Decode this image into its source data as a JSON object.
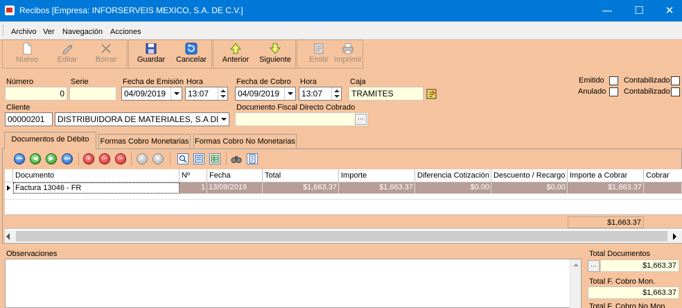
{
  "window": {
    "title": "Recibos [Empresa: INFORSERVEIS MEXICO, S.A. DE C.V.]",
    "minimize_glyph": "—",
    "maximize_glyph": "☐",
    "close_glyph": "✕"
  },
  "menu": [
    "Archivo",
    "Ver",
    "Navegación",
    "Acciones"
  ],
  "toolbar": {
    "nuevo": "Nuevo",
    "editar": "Editar",
    "borrar": "Borrar",
    "guardar": "Guardar",
    "cancelar": "Cancelar",
    "anterior": "Anterior",
    "siguiente": "Siguiente",
    "emitir": "Emitir",
    "imprimir": "Imprimir"
  },
  "form": {
    "numero_label": "Número",
    "numero_value": "0",
    "serie_label": "Serie",
    "serie_value": "",
    "fecha_emision_label": "Fecha de Emisión",
    "fecha_emision_value": "04/09/2019",
    "hora_emision_label": "Hora",
    "hora_emision_value": "13:07",
    "fecha_cobro_label": "Fecha de Cobro",
    "fecha_cobro_value": "04/09/2019",
    "hora_cobro_label": "Hora",
    "hora_cobro_value": "13:07",
    "caja_label": "Caja",
    "caja_value": "TRAMITES",
    "emitido_label": "Emitido",
    "anulado_label": "Anulado",
    "contabilizado1_label": "Contabilizado",
    "contabilizado2_label": "Contabilizado",
    "cliente_label": "Cliente",
    "cliente_code": "00000201",
    "cliente_name": "DISTRIBUIDORA  DE MATERIALES, S.A  DE C.V.",
    "doc_fiscal_label": "Documento Fiscal Directo Cobrado",
    "doc_fiscal_value": "",
    "ellipsis": "···"
  },
  "tabs": [
    {
      "label": "Documentos de Débito",
      "active": true
    },
    {
      "label": "Formas Cobro Monetarias",
      "active": false
    },
    {
      "label": "Formas Cobro No Monetarias",
      "active": false
    }
  ],
  "grid": {
    "headers": [
      "Documento",
      "Nº",
      "Fecha",
      "Total",
      "Importe",
      "Diferencia Cotización",
      "Descuento / Recargo",
      "Importe a Cobrar",
      "Cobrar"
    ],
    "rows": [
      {
        "documento": "Factura 13046 - FR",
        "numero": "1",
        "fecha": "13/09/2019",
        "total": "$1,663.37",
        "importe": "$1,663.37",
        "diferencia": "$0.00",
        "descuento": "$0.00",
        "importe_cobrar": "$1,663.37",
        "cobrar": ""
      }
    ],
    "footer_total": "$1,663.37"
  },
  "observaciones_label": "Observaciones",
  "totals": {
    "documentos_label": "Total Documentos",
    "documentos_value": "$1,663.37",
    "fcobro_mon_label": "Total F. Cobro Mon.",
    "fcobro_mon_value": "$1,663.37",
    "fcobro_nomon_label": "Total F. Cobro No Mon."
  },
  "colors": {
    "title_bar": "#0078d7",
    "background": "#f5c39d",
    "selected_row": "#b79d96",
    "field_yellow": "#ffffe1"
  }
}
